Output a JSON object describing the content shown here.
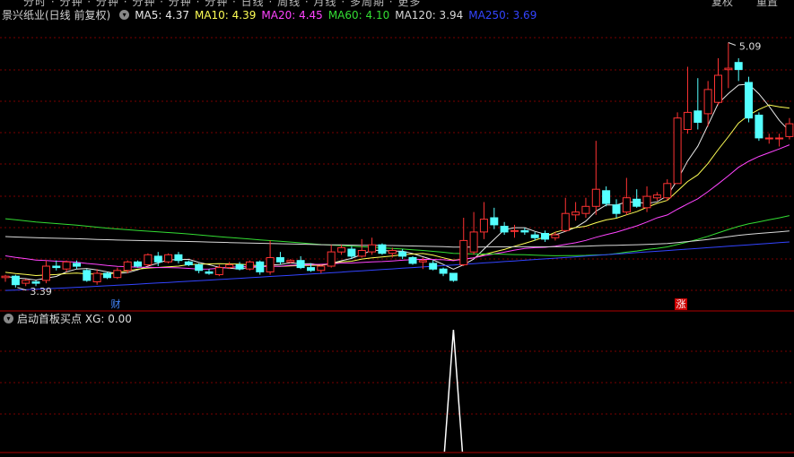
{
  "toolbar": {
    "tabs": "分时 · 分钟 · 分钟 · 分钟 · 分钟 · 分钟 · 日线 · 周线 · 月线 · 多周期 · 更多",
    "right_tabs": [
      "复权",
      "重置"
    ]
  },
  "header": {
    "stock_name": "景兴纸业(日线 前复权)",
    "ma": [
      {
        "label": "MA5: 4.37",
        "color": "#e8e8e8"
      },
      {
        "label": "MA10: 4.39",
        "color": "#ffff55"
      },
      {
        "label": "MA20: 4.45",
        "color": "#ff44ff"
      },
      {
        "label": "MA60: 4.10",
        "color": "#33dd33"
      },
      {
        "label": "MA120: 3.94",
        "color": "#d8d8d8"
      },
      {
        "label": "MA250: 3.69",
        "color": "#3344ff"
      }
    ]
  },
  "annotations": {
    "high_label": "5.09",
    "low_label": "3.39",
    "badge_cai": "财",
    "badge_zhang": "涨"
  },
  "indicator": {
    "title": "启动首板买点",
    "value_label": "XG: 0.00",
    "spike_index": 44
  },
  "colors": {
    "up": "#ff3333",
    "down": "#54ffff",
    "grid": "#7a0000",
    "signal": "#ffffff"
  },
  "chart_data": {
    "type": "candlestick",
    "ylim": [
      3.3,
      5.2
    ],
    "candles": [
      [
        3.44,
        3.45,
        3.41,
        3.46
      ],
      [
        3.45,
        3.39,
        3.37,
        3.46
      ],
      [
        3.4,
        3.42,
        3.38,
        3.43
      ],
      [
        3.41,
        3.4,
        3.38,
        3.42
      ],
      [
        3.42,
        3.52,
        3.4,
        3.56
      ],
      [
        3.52,
        3.51,
        3.49,
        3.56
      ],
      [
        3.5,
        3.55,
        3.48,
        3.56
      ],
      [
        3.54,
        3.52,
        3.5,
        3.56
      ],
      [
        3.49,
        3.42,
        3.41,
        3.5
      ],
      [
        3.41,
        3.47,
        3.39,
        3.5
      ],
      [
        3.47,
        3.44,
        3.43,
        3.48
      ],
      [
        3.44,
        3.49,
        3.43,
        3.51
      ],
      [
        3.49,
        3.55,
        3.47,
        3.56
      ],
      [
        3.55,
        3.52,
        3.51,
        3.56
      ],
      [
        3.53,
        3.6,
        3.52,
        3.61
      ],
      [
        3.59,
        3.55,
        3.52,
        3.62
      ],
      [
        3.55,
        3.6,
        3.54,
        3.61
      ],
      [
        3.6,
        3.56,
        3.54,
        3.62
      ],
      [
        3.55,
        3.53,
        3.52,
        3.56
      ],
      [
        3.53,
        3.49,
        3.47,
        3.54
      ],
      [
        3.48,
        3.47,
        3.46,
        3.5
      ],
      [
        3.46,
        3.51,
        3.45,
        3.53
      ],
      [
        3.51,
        3.53,
        3.5,
        3.55
      ],
      [
        3.53,
        3.5,
        3.49,
        3.55
      ],
      [
        3.5,
        3.55,
        3.49,
        3.56
      ],
      [
        3.55,
        3.48,
        3.46,
        3.56
      ],
      [
        3.48,
        3.58,
        3.46,
        3.7
      ],
      [
        3.58,
        3.55,
        3.53,
        3.62
      ],
      [
        3.55,
        3.56,
        3.54,
        3.57
      ],
      [
        3.56,
        3.51,
        3.5,
        3.59
      ],
      [
        3.51,
        3.49,
        3.48,
        3.54
      ],
      [
        3.49,
        3.52,
        3.47,
        3.53
      ],
      [
        3.52,
        3.62,
        3.51,
        3.67
      ],
      [
        3.62,
        3.65,
        3.6,
        3.67
      ],
      [
        3.64,
        3.59,
        3.57,
        3.66
      ],
      [
        3.59,
        3.63,
        3.58,
        3.71
      ],
      [
        3.62,
        3.67,
        3.6,
        3.72
      ],
      [
        3.67,
        3.61,
        3.6,
        3.68
      ],
      [
        3.61,
        3.63,
        3.58,
        3.65
      ],
      [
        3.62,
        3.59,
        3.57,
        3.64
      ],
      [
        3.58,
        3.54,
        3.53,
        3.59
      ],
      [
        3.55,
        3.56,
        3.5,
        3.58
      ],
      [
        3.54,
        3.5,
        3.49,
        3.56
      ],
      [
        3.5,
        3.47,
        3.45,
        3.51
      ],
      [
        3.47,
        3.42,
        3.41,
        3.47
      ],
      [
        3.53,
        3.7,
        3.52,
        3.86
      ],
      [
        3.62,
        3.76,
        3.6,
        3.9
      ],
      [
        3.76,
        3.85,
        3.71,
        3.97
      ],
      [
        3.86,
        3.81,
        3.78,
        3.93
      ],
      [
        3.8,
        3.76,
        3.74,
        3.83
      ],
      [
        3.77,
        3.77,
        3.72,
        3.81
      ],
      [
        3.77,
        3.76,
        3.74,
        3.79
      ],
      [
        3.74,
        3.72,
        3.7,
        3.76
      ],
      [
        3.75,
        3.71,
        3.69,
        3.77
      ],
      [
        3.72,
        3.74,
        3.7,
        3.76
      ],
      [
        3.77,
        3.89,
        3.76,
        4.0
      ],
      [
        3.88,
        3.9,
        3.84,
        3.97
      ],
      [
        3.89,
        3.94,
        3.86,
        4.0
      ],
      [
        3.94,
        4.06,
        3.88,
        4.4
      ],
      [
        4.05,
        3.96,
        3.94,
        4.08
      ],
      [
        3.95,
        3.89,
        3.86,
        3.99
      ],
      [
        3.9,
        4.0,
        3.88,
        4.14
      ],
      [
        3.99,
        3.94,
        3.93,
        4.06
      ],
      [
        3.93,
        4.01,
        3.9,
        4.08
      ],
      [
        4.0,
        4.02,
        3.98,
        4.04
      ],
      [
        4.0,
        4.1,
        3.98,
        4.13
      ],
      [
        4.1,
        4.56,
        4.1,
        4.6
      ],
      [
        4.48,
        4.6,
        4.45,
        4.92
      ],
      [
        4.61,
        4.53,
        4.48,
        4.84
      ],
      [
        4.59,
        4.76,
        4.5,
        4.82
      ],
      [
        4.67,
        4.86,
        4.65,
        4.98
      ],
      [
        4.9,
        4.91,
        4.77,
        5.09
      ],
      [
        4.95,
        4.9,
        4.82,
        4.98
      ],
      [
        4.81,
        4.56,
        4.53,
        4.85
      ],
      [
        4.58,
        4.42,
        4.4,
        4.6
      ],
      [
        4.42,
        4.42,
        4.38,
        4.45
      ],
      [
        4.42,
        4.42,
        4.36,
        4.45
      ],
      [
        4.43,
        4.52,
        4.41,
        4.56
      ]
    ]
  }
}
